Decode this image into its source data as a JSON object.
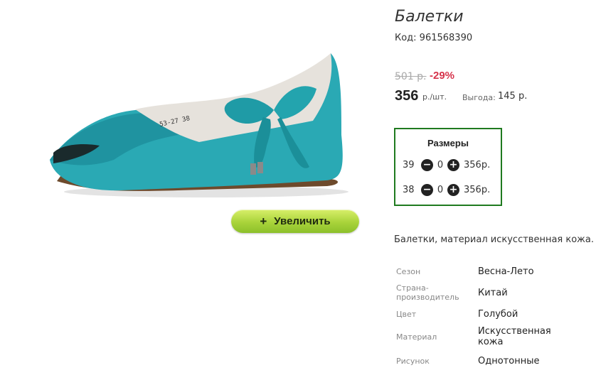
{
  "product": {
    "title": "Балетки",
    "code": "Код: 961568390",
    "old_price": "501 р.",
    "discount": "-29%",
    "price": "356",
    "price_unit": "р./шт.",
    "profit_label": "Выгода:",
    "profit_value": "145 р.",
    "image": {
      "icon": "shoe-photo",
      "printed_text": "53-27  38"
    },
    "zoom_label": "Увеличить"
  },
  "sizes": {
    "title": "Размеры",
    "rows": [
      {
        "size": "39",
        "qty": "0",
        "price": "356р."
      },
      {
        "size": "38",
        "qty": "0",
        "price": "356р."
      }
    ]
  },
  "description": "Балетки, материал искусственная кожа.",
  "specs": [
    {
      "key": "Сезон",
      "value": "Весна-Лето"
    },
    {
      "key": "Страна-\nпроизводитель",
      "value": "Китай"
    },
    {
      "key": "Цвет",
      "value": "Голубой"
    },
    {
      "key": "Материал",
      "value": "Искусственная\nкожа"
    },
    {
      "key": "Рисунок",
      "value": "Однотонные"
    }
  ],
  "colors": {
    "shoe": "#27aeb8",
    "discount": "#d6334b",
    "sizes_border": "#1f7a1f",
    "zoom_button": "#a9d33a"
  }
}
